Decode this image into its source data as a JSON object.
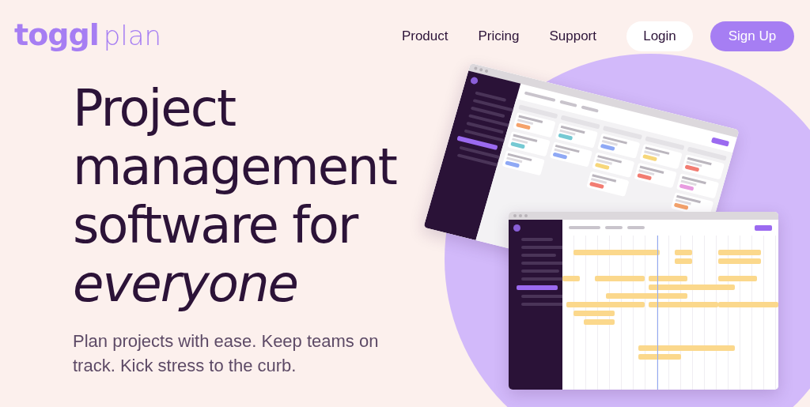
{
  "header": {
    "logo": {
      "brand": "toggl",
      "product": "plan"
    },
    "nav": [
      "Product",
      "Pricing",
      "Support"
    ],
    "login": "Login",
    "signup": "Sign Up"
  },
  "hero": {
    "title_lines": [
      "Project",
      "management",
      "software for"
    ],
    "title_emphasis": "everyone",
    "subtitle": "Plan projects with ease. Keep teams on track. Kick stress to the curb."
  }
}
